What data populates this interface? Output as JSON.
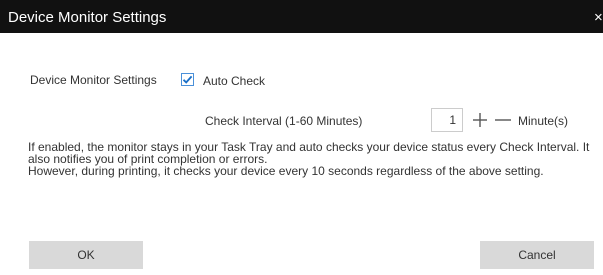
{
  "window": {
    "title": "Device Monitor Settings",
    "close_symbol": "×"
  },
  "settings": {
    "main_label": "Device Monitor Settings",
    "auto_check_label": "Auto Check",
    "auto_check_checked": true,
    "interval_label": "Check Interval (1-60 Minutes)",
    "interval_value": "1",
    "unit_label": "Minute(s)"
  },
  "description": {
    "line1": "If enabled, the monitor stays in your Task Tray and auto checks your device status every Check Interval. It also notifies you of print completion or errors.",
    "line2": "However, during printing, it checks your device every 10 seconds regardless of the above setting."
  },
  "buttons": {
    "ok_label": "OK",
    "cancel_label": "Cancel"
  },
  "icons": {
    "close": "close-icon",
    "checkmark": "checkmark-icon",
    "plus": "plus-icon",
    "minus": "minus-icon"
  },
  "colors": {
    "titlebar": "#111111",
    "accent": "#4a90d9",
    "button": "#d9d9d9"
  }
}
